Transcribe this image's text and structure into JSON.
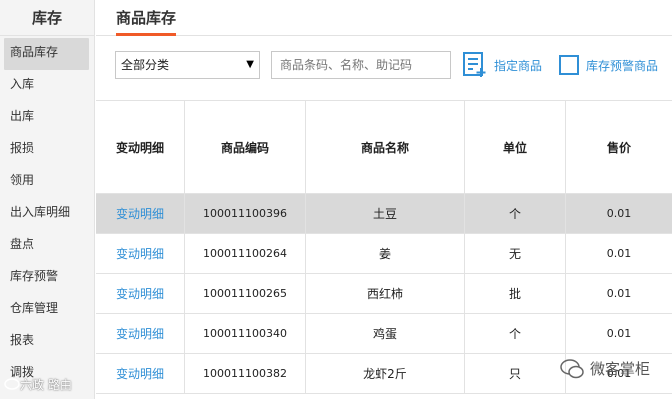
{
  "sidebar": {
    "title": "库存",
    "items": [
      {
        "label": "商品库存",
        "active": true
      },
      {
        "label": "入库"
      },
      {
        "label": "出库"
      },
      {
        "label": "报损"
      },
      {
        "label": "领用"
      },
      {
        "label": "出入库明细"
      },
      {
        "label": "盘点"
      },
      {
        "label": "库存预警"
      },
      {
        "label": "仓库管理"
      },
      {
        "label": "报表"
      },
      {
        "label": "调拨"
      }
    ]
  },
  "tab": {
    "label": "商品库存",
    "accent": "#f05a28"
  },
  "toolbar": {
    "category_value": "全部分类",
    "search_placeholder": "商品条码、名称、助记码",
    "assign_label": "指定商品",
    "warn_label": "库存预警商品",
    "link_color": "#2f8fd6"
  },
  "table": {
    "headers": [
      "变动明细",
      "商品编码",
      "商品名称",
      "单位",
      "售价"
    ],
    "rows": [
      {
        "detail": "变动明细",
        "code": "100011100396",
        "name": "土豆",
        "unit": "个",
        "price": "0.01"
      },
      {
        "detail": "变动明细",
        "code": "100011100264",
        "name": "姜",
        "unit": "无",
        "price": "0.01"
      },
      {
        "detail": "变动明细",
        "code": "100011100265",
        "name": "西红柿",
        "unit": "批",
        "price": "0.01"
      },
      {
        "detail": "变动明细",
        "code": "100011100340",
        "name": "鸡蛋",
        "unit": "个",
        "price": "0.01"
      },
      {
        "detail": "变动明细",
        "code": "100011100382",
        "name": "龙虾2斤",
        "unit": "只",
        "price": "0.01"
      }
    ]
  },
  "watermarks": {
    "left": "六政 路由",
    "right": "微客掌柜"
  }
}
